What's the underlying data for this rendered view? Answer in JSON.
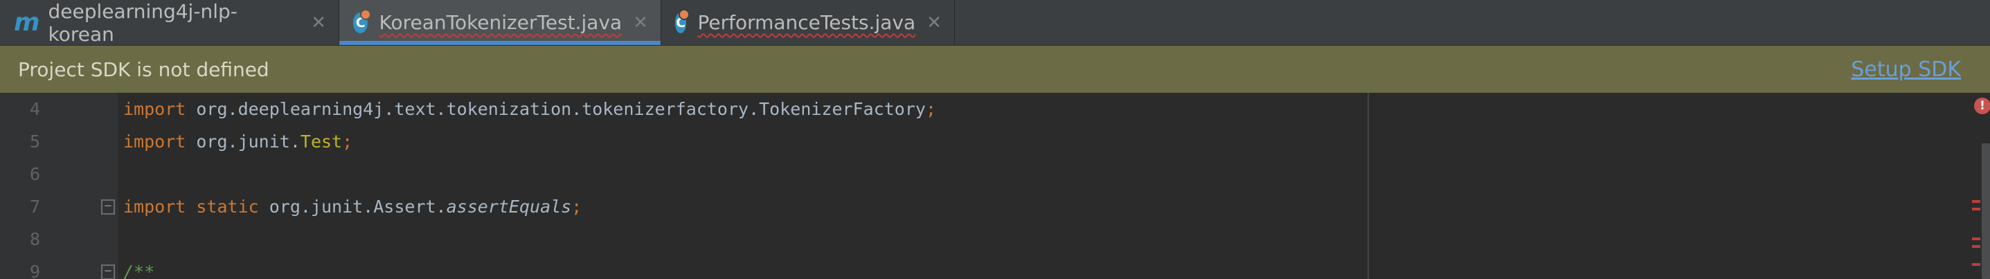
{
  "tabs": [
    {
      "icon": "module-icon",
      "icon_glyph": "m",
      "label": "deeplearning4j-nlp-korean",
      "active": false,
      "error": false,
      "close": "✕"
    },
    {
      "icon": "java-class-icon",
      "icon_glyph": "C",
      "label": "KoreanTokenizerTest.java",
      "active": true,
      "error": true,
      "close": "✕"
    },
    {
      "icon": "java-class-icon",
      "icon_glyph": "C",
      "label": "PerformanceTests.java",
      "active": false,
      "error": true,
      "close": "✕"
    }
  ],
  "banner": {
    "message": "Project SDK is not defined",
    "action": "Setup SDK"
  },
  "editor": {
    "lines": [
      {
        "number": "4",
        "kw": "import",
        "text": " org.deeplearning4j.text.tokenization.tokenizerfactory.TokenizerFactory",
        "semi": ";"
      },
      {
        "number": "5",
        "kw": "import",
        "text": " org.junit.",
        "cls": "Test",
        "semi": ";"
      },
      {
        "number": "6"
      },
      {
        "number": "7",
        "kw": "import static",
        "text": " org.junit.Assert.",
        "ital": "assertEquals",
        "semi": ";"
      },
      {
        "number": "8"
      },
      {
        "number": "9",
        "cmt": "/**"
      }
    ]
  },
  "indicators": {
    "error_glyph": "!"
  },
  "colors": {
    "keyword": "#cc7832",
    "annotation_class": "#bbb529",
    "banner_bg": "#6b6b45",
    "link": "#6a9fd8",
    "active_tab_underline": "#4a88c7",
    "error": "#bc3f3c"
  }
}
